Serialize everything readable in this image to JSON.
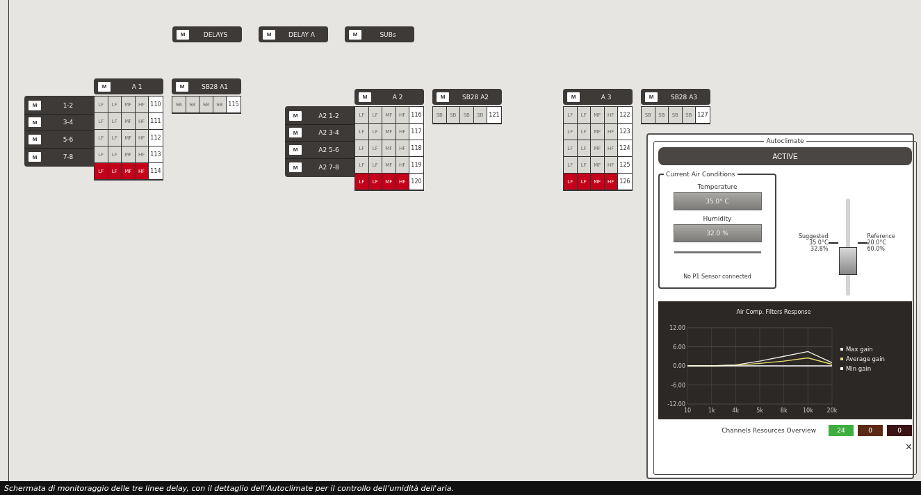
{
  "top_buttons": [
    {
      "mute": "M",
      "label": "DELAYS"
    },
    {
      "mute": "M",
      "label": "DELAY A"
    },
    {
      "mute": "M",
      "label": "SUBs"
    }
  ],
  "groups": [
    {
      "header": {
        "mute": "M",
        "label": "A 1"
      },
      "zones": [
        {
          "mute": "M",
          "label": "1-2"
        },
        {
          "mute": "M",
          "label": "3-4"
        },
        {
          "mute": "M",
          "label": "5-6"
        },
        {
          "mute": "M",
          "label": "7-8"
        }
      ],
      "rows": [
        {
          "cells": [
            "LF",
            "LF",
            "MF",
            "HF"
          ],
          "number": "110",
          "alert": false
        },
        {
          "cells": [
            "LF",
            "LF",
            "MF",
            "HF"
          ],
          "number": "111",
          "alert": false
        },
        {
          "cells": [
            "LF",
            "LF",
            "MF",
            "HF"
          ],
          "number": "112",
          "alert": false
        },
        {
          "cells": [
            "LF",
            "LF",
            "MF",
            "HF"
          ],
          "number": "113",
          "alert": false
        },
        {
          "cells": [
            "LF",
            "LF",
            "MF",
            "HF"
          ],
          "number": "114",
          "alert": true
        }
      ],
      "sub": {
        "header": {
          "mute": "M",
          "label": "SB28 A1"
        },
        "cells": [
          "SB",
          "SB",
          "SB",
          "SB"
        ],
        "number": "115"
      }
    },
    {
      "header": {
        "mute": "M",
        "label": "A 2"
      },
      "zones": [
        {
          "mute": "M",
          "label": "A2 1-2"
        },
        {
          "mute": "M",
          "label": "A2 3-4"
        },
        {
          "mute": "M",
          "label": "A2 5-6"
        },
        {
          "mute": "M",
          "label": "A2 7-8"
        }
      ],
      "rows": [
        {
          "cells": [
            "LF",
            "LF",
            "MF",
            "HF"
          ],
          "number": "116",
          "alert": false
        },
        {
          "cells": [
            "LF",
            "LF",
            "MF",
            "HF"
          ],
          "number": "117",
          "alert": false
        },
        {
          "cells": [
            "LF",
            "LF",
            "MF",
            "HF"
          ],
          "number": "118",
          "alert": false
        },
        {
          "cells": [
            "LF",
            "LF",
            "MF",
            "HF"
          ],
          "number": "119",
          "alert": false
        },
        {
          "cells": [
            "LF",
            "LF",
            "MF",
            "HF"
          ],
          "number": "120",
          "alert": true
        }
      ],
      "sub": {
        "header": {
          "mute": "M",
          "label": "SB28 A2"
        },
        "cells": [
          "SB",
          "SB",
          "SB",
          "SB"
        ],
        "number": "121"
      }
    },
    {
      "header": {
        "mute": "M",
        "label": "A 3"
      },
      "rows": [
        {
          "cells": [
            "LF",
            "LF",
            "MF",
            "HF"
          ],
          "number": "122",
          "alert": false
        },
        {
          "cells": [
            "LF",
            "LF",
            "MF",
            "HF"
          ],
          "number": "123",
          "alert": false
        },
        {
          "cells": [
            "LF",
            "LF",
            "MF",
            "HF"
          ],
          "number": "124",
          "alert": false
        },
        {
          "cells": [
            "LF",
            "LF",
            "MF",
            "HF"
          ],
          "number": "125",
          "alert": false
        },
        {
          "cells": [
            "LF",
            "LF",
            "MF",
            "HF"
          ],
          "number": "126",
          "alert": true
        }
      ],
      "sub": {
        "header": {
          "mute": "M",
          "label": "SB28 A3"
        },
        "cells": [
          "SB",
          "SB",
          "SB",
          "SB"
        ],
        "number": "127"
      }
    }
  ],
  "autoclimate": {
    "title": "Autoclimate",
    "status": "ACTIVE",
    "conditions": {
      "title": "Current Air Conditions",
      "temperature_label": "Temperature",
      "temperature": "35.0° C",
      "humidity_label": "Humidity",
      "humidity": "32.0 %",
      "sensor_note": "No P1 Sensor connected"
    },
    "slider": {
      "level": 0.36,
      "suggested": [
        "Suggested",
        "35.0°C",
        "32.8%"
      ],
      "reference": [
        "Reference",
        "20.0°C",
        "60.0%"
      ]
    },
    "chart_data": {
      "type": "line",
      "title": "Air Comp. Filters Response",
      "x": [
        "10",
        "1k",
        "4k",
        "5k",
        "8k",
        "10k",
        "20k"
      ],
      "yticks": [
        {
          "value": 12,
          "label": "12.00"
        },
        {
          "value": 6,
          "label": "6.00"
        },
        {
          "value": 0,
          "label": "0.00"
        },
        {
          "value": -6,
          "label": "-6.00"
        },
        {
          "value": -12,
          "label": "-12.00"
        }
      ],
      "ylim": [
        -12,
        12
      ],
      "grid": true,
      "legend": "right",
      "series": [
        {
          "name": "Max gain",
          "color": "#f0ece4",
          "values": [
            0,
            0,
            0.3,
            1.5,
            3,
            4.5,
            1
          ]
        },
        {
          "name": "Average gain",
          "color": "#e8e070",
          "values": [
            0,
            0,
            0.2,
            0.8,
            1.5,
            2.5,
            0.5
          ]
        },
        {
          "name": "Min gain",
          "color": "#ffffff",
          "values": [
            0,
            0,
            0,
            0,
            0,
            0,
            0
          ]
        }
      ]
    },
    "resources": {
      "label": "Channels Resources Overview",
      "counts": [
        {
          "value": "24",
          "color": "#3fae3f"
        },
        {
          "value": "0",
          "color": "#5a2a14"
        },
        {
          "value": "0",
          "color": "#3a1414"
        }
      ]
    },
    "close": "×"
  },
  "caption": "Schermata di monitoraggio delle tre linee delay, con il dettaglio dell’Autoclimate per il controllo dell’umidità dell'aria."
}
